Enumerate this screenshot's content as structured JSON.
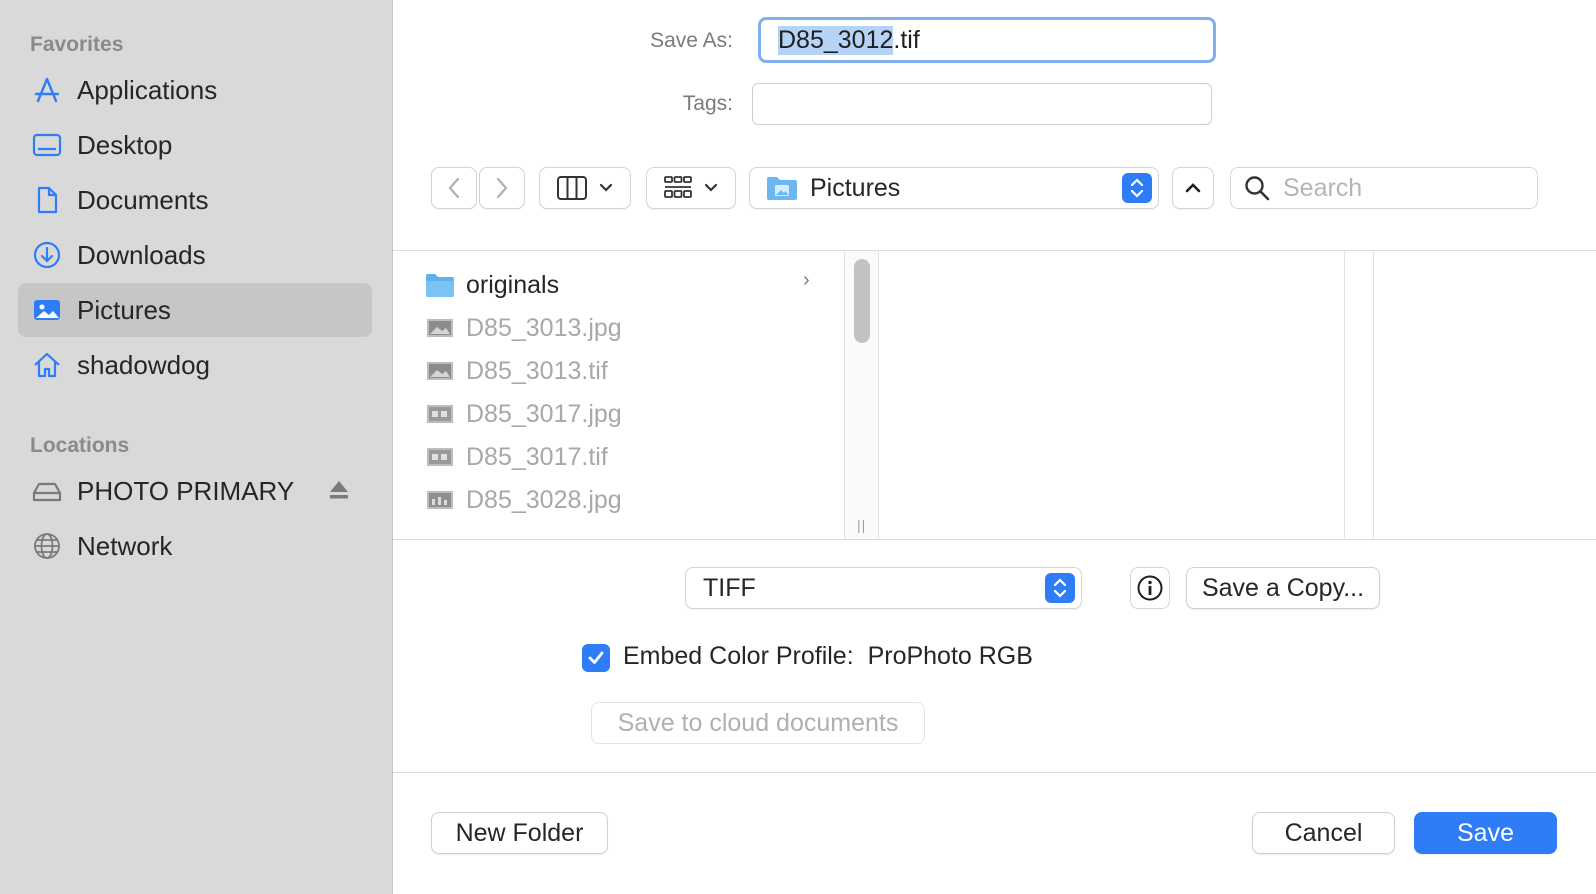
{
  "sidebar": {
    "favorites_header": "Favorites",
    "locations_header": "Locations",
    "favorites": [
      {
        "label": "Applications",
        "icon": "applications-icon"
      },
      {
        "label": "Desktop",
        "icon": "desktop-icon"
      },
      {
        "label": "Documents",
        "icon": "document-icon"
      },
      {
        "label": "Downloads",
        "icon": "downloads-icon"
      },
      {
        "label": "Pictures",
        "icon": "pictures-icon",
        "selected": true
      },
      {
        "label": "shadowdog",
        "icon": "home-icon"
      }
    ],
    "locations": [
      {
        "label": "PHOTO PRIMARY",
        "icon": "drive-icon"
      },
      {
        "label": "Network",
        "icon": "globe-icon"
      }
    ]
  },
  "save_as": {
    "label": "Save As:",
    "value_selected": "D85_3012",
    "value_rest": ".tif"
  },
  "tags": {
    "label": "Tags:",
    "value": ""
  },
  "toolbar": {
    "location": "Pictures",
    "search_placeholder": "Search"
  },
  "browser": {
    "files": [
      {
        "name": "originals",
        "type": "folder",
        "enabled": true
      },
      {
        "name": "D85_3013.jpg",
        "type": "image",
        "enabled": false
      },
      {
        "name": "D85_3013.tif",
        "type": "image",
        "enabled": false
      },
      {
        "name": "D85_3017.jpg",
        "type": "image",
        "enabled": false
      },
      {
        "name": "D85_3017.tif",
        "type": "image",
        "enabled": false
      },
      {
        "name": "D85_3028.jpg",
        "type": "image",
        "enabled": false
      }
    ]
  },
  "options": {
    "format": "TIFF",
    "save_copy_label": "Save a Copy...",
    "embed_label": "Embed Color Profile:",
    "embed_profile": "ProPhoto RGB",
    "embed_checked": true,
    "cloud_label": "Save to cloud documents"
  },
  "footer": {
    "new_folder": "New Folder",
    "cancel": "Cancel",
    "save": "Save"
  },
  "colors": {
    "accent": "#2f7df6",
    "sidebar_bg": "#d9d9d9",
    "selection": "#b5d3f7"
  }
}
